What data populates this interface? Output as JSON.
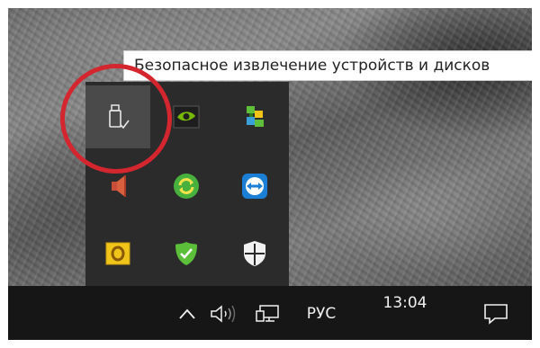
{
  "tooltip": {
    "text": "Безопасное извлечение устройств и дисков"
  },
  "tray_flyout": {
    "icons": [
      {
        "name": "usb-safe-remove-icon",
        "selected": true
      },
      {
        "name": "nvidia-icon",
        "selected": false
      },
      {
        "name": "network-app-icon",
        "selected": false
      },
      {
        "name": "speaker-app-icon",
        "selected": false
      },
      {
        "name": "sync-app-icon",
        "selected": false
      },
      {
        "name": "teamviewer-icon",
        "selected": false
      },
      {
        "name": "outlook-icon",
        "selected": false
      },
      {
        "name": "green-shield-icon",
        "selected": false
      },
      {
        "name": "windows-defender-icon",
        "selected": false
      }
    ]
  },
  "taskbar": {
    "language": "РУС",
    "clock": "13:04",
    "icons": [
      "chevron-up-icon",
      "volume-icon",
      "network-icon",
      "notifications-icon"
    ]
  },
  "colors": {
    "annotation": "#d3262e",
    "taskbar": "#161616",
    "flyout": "#2b2b2b",
    "selected_cell": "#4a4a4a"
  }
}
